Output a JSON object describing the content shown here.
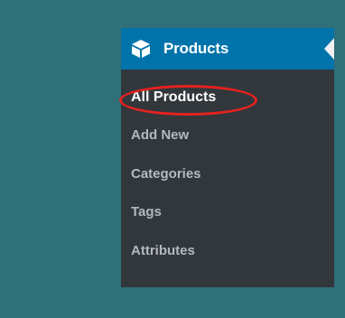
{
  "menu": {
    "header_label": "Products",
    "header_icon": "product-box-icon",
    "items": [
      {
        "label": "All Products",
        "active": true
      },
      {
        "label": "Add New",
        "active": false
      },
      {
        "label": "Categories",
        "active": false
      },
      {
        "label": "Tags",
        "active": false
      },
      {
        "label": "Attributes",
        "active": false
      }
    ]
  },
  "colors": {
    "background": "#2f7079",
    "menu_background": "#32373c",
    "header_background": "#0073aa",
    "item_text": "#b4b9be",
    "active_text": "#ffffff",
    "highlight_ring": "#e3221f"
  }
}
